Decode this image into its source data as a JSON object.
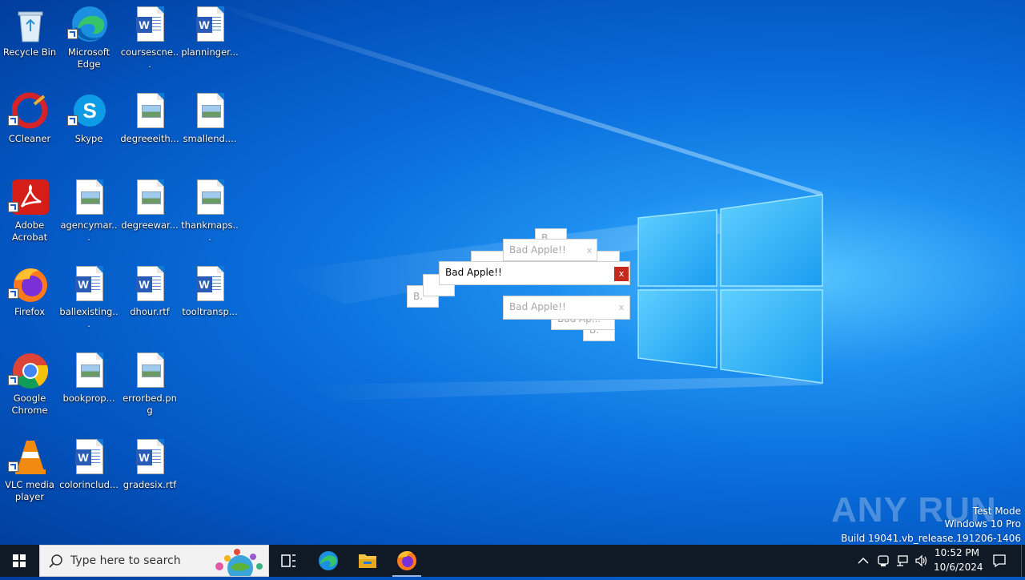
{
  "desktop": {
    "icons": [
      {
        "label": "Recycle Bin"
      },
      {
        "label": "Microsoft Edge"
      },
      {
        "label": "coursescne..."
      },
      {
        "label": "planninger..."
      },
      {
        "label": "CCleaner"
      },
      {
        "label": "Skype"
      },
      {
        "label": "degreeeith..."
      },
      {
        "label": "smallend...."
      },
      {
        "label": "Adobe Acrobat"
      },
      {
        "label": "agencymar..."
      },
      {
        "label": "degreewar..."
      },
      {
        "label": "thankmaps..."
      },
      {
        "label": "Firefox"
      },
      {
        "label": "ballexisting..."
      },
      {
        "label": "dhour.rtf"
      },
      {
        "label": "tooltransp..."
      },
      {
        "label": "Google Chrome"
      },
      {
        "label": "bookprop..."
      },
      {
        "label": "errorbed.png"
      },
      {
        "label": "VLC media player"
      },
      {
        "label": "colorinclud..."
      },
      {
        "label": "gradesix.rtf"
      }
    ]
  },
  "popups": {
    "main_title": "Bad Apple!!",
    "faded_title_1": "Bad Apple!!",
    "faded_title_2": "Bad Apple!!",
    "partial_1": "B.",
    "partial_2": "Bad Ap...",
    "partial_3": "B",
    "partial_4": "B.",
    "close_glyph": "x"
  },
  "taskbar": {
    "search_placeholder": "Type here to search",
    "time": "10:52 PM",
    "date": "10/6/2024"
  },
  "watermark": {
    "line1": "Test Mode",
    "line2": "Windows 10 Pro",
    "line3": "Build 19041.vb_release.191206-1406",
    "logo": "ANY RUN"
  },
  "colors": {
    "taskbar": "#101a26",
    "close_active": "#c42b1c"
  }
}
